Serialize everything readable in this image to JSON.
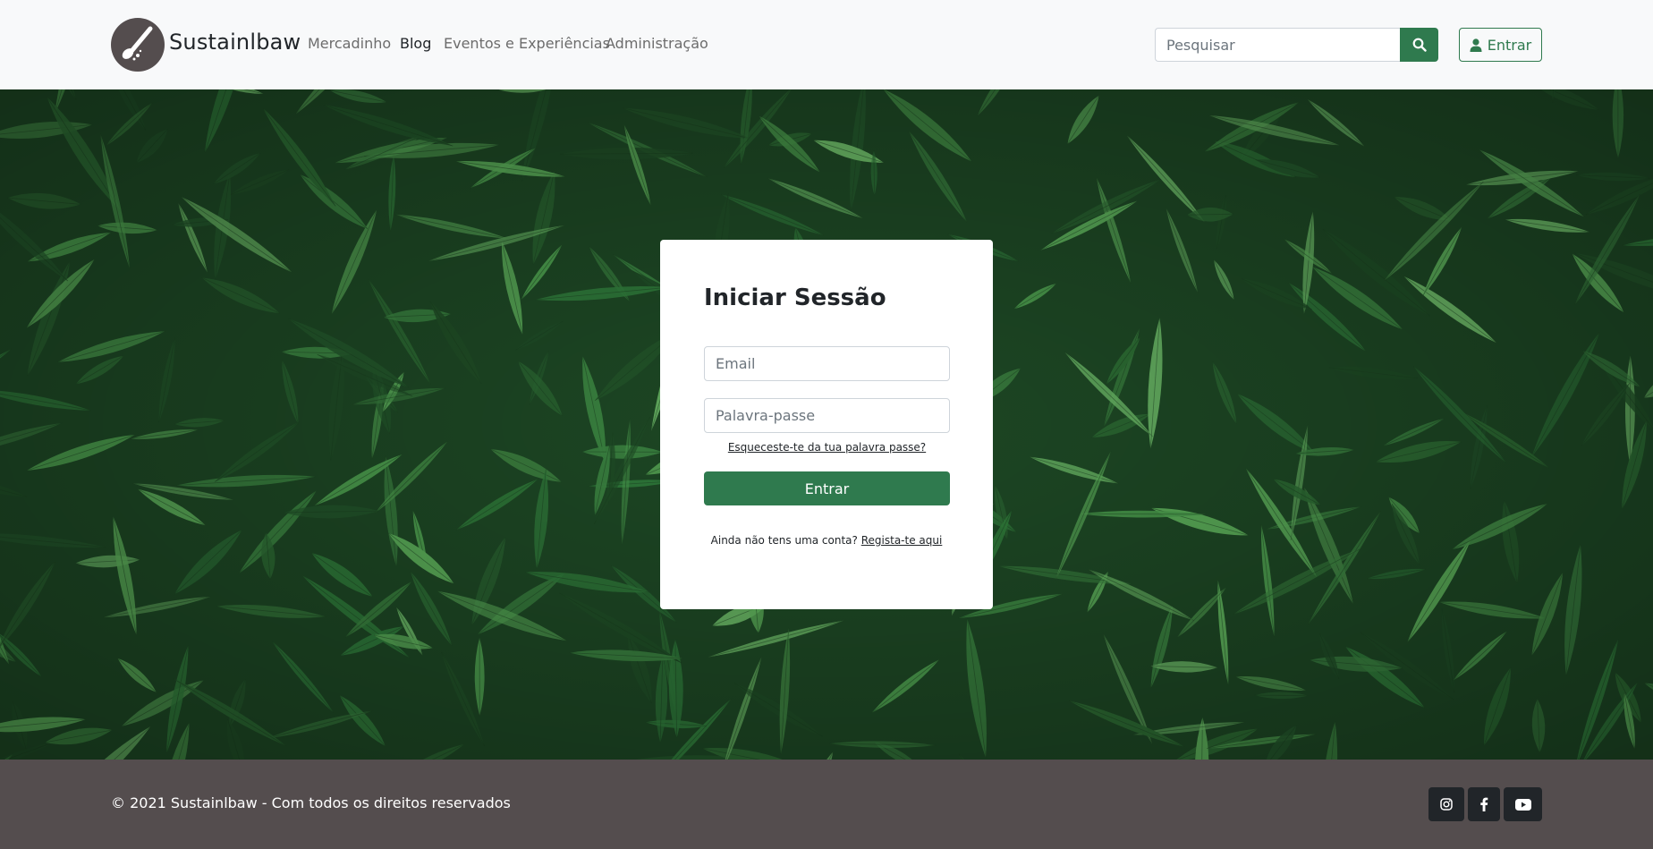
{
  "brand": {
    "name": "Sustainlbaw",
    "logo_icon": "spoon-logo-icon"
  },
  "nav": {
    "links": [
      {
        "label": "Mercadinho",
        "active": false
      },
      {
        "label": "Blog",
        "active": true
      },
      {
        "label": "Eventos e Experiências",
        "active": false
      },
      {
        "label": "Administração",
        "active": false
      }
    ]
  },
  "search": {
    "placeholder": "Pesquisar",
    "icon": "search-icon"
  },
  "header_login": {
    "label": "Entrar",
    "icon": "user-icon"
  },
  "login_card": {
    "title": "Iniciar Sessão",
    "email_placeholder": "Email",
    "password_placeholder": "Palavra-passe",
    "forgot_label": "Esqueceste-te da tua palavra passe?",
    "submit_label": "Entrar",
    "register_prompt": "Ainda não tens uma conta?",
    "register_link": "Regista-te aqui"
  },
  "footer": {
    "copyright": "© 2021 Sustainlbaw - Com todos os direitos reservados",
    "social": [
      "instagram-icon",
      "facebook-icon",
      "youtube-icon"
    ]
  },
  "colors": {
    "primary": "#2f7a4e",
    "navbar_bg": "#f8f9fa",
    "footer_bg": "#544d4e",
    "social_bg": "#212529"
  }
}
